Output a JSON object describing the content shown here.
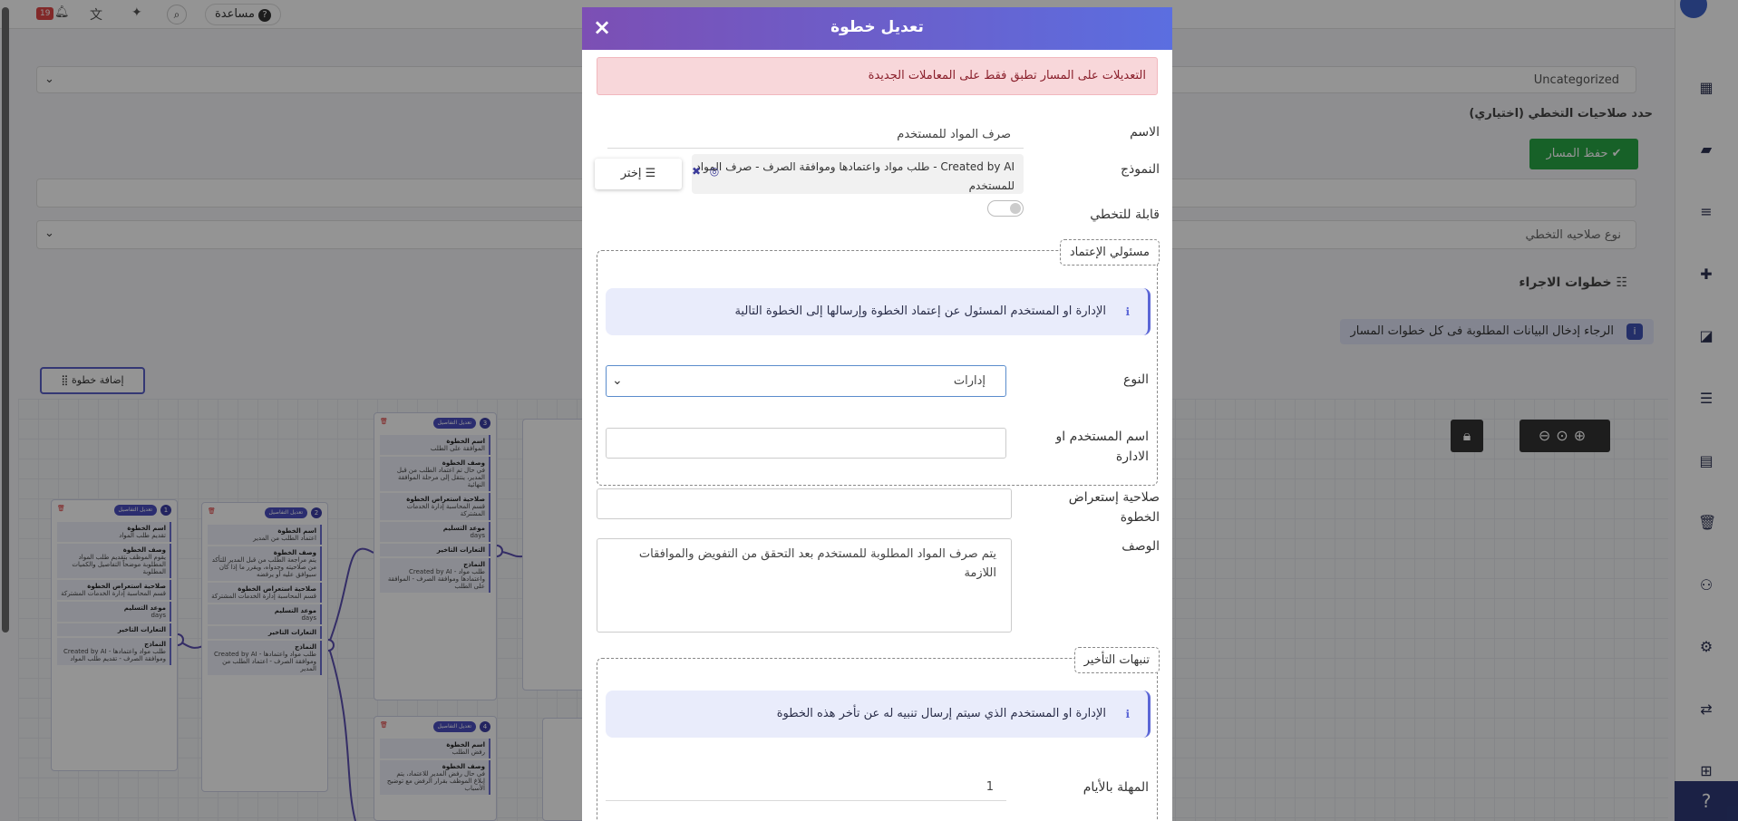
{
  "topbar": {
    "help_label": "مساعدة",
    "notification_count": "19"
  },
  "page": {
    "field_hint": "Uncategorized",
    "delegation_heading": "حدد صلاحيات التخطي (اختياري)",
    "save_path_label": "حفظ المسار",
    "delegation_type_placeholder": "نوع صلاحيه التخطي",
    "steps_heading": "خطوات الاجراء",
    "steps_notice": "الرجاء إدخال البيانات المطلوبة فى كل خطوات المسار",
    "add_step_label": "إضافة خطوة"
  },
  "flow_cards": [
    {
      "num": "1",
      "edit": "تعديل التفاصيل",
      "name_h": "اسم الخطوة",
      "name": "تقديم طلب المواد",
      "desc_h": "وصف الخطوة",
      "desc": "يقوم الموظف بتقديم طلب المواد المطلوبة موضحاً التفاصيل والكميات المطلوبة",
      "perm_h": "صلاحية استعراض الخطوة",
      "perm": "قسم المحاسبة إدارة الخدمات المشتركة",
      "due_h": "موعد التسليم",
      "due": "days",
      "alert_h": "التعارات التاخير",
      "model_h": "النماذج",
      "model": "Created by AI - طلب مواد واعتمادها وموافقة الصرف - تقديم طلب المواد"
    },
    {
      "num": "2",
      "edit": "تعديل التفاصيل",
      "name_h": "اسم الخطوة",
      "name": "اعتماد الطلب من المدير",
      "desc_h": "وصف الخطوة",
      "desc": "يتم مراجعة الطلب من قبل المدير للتأكد من صلاحيته وجدواه، ويقرر ما إذا كان سيوافق عليه أو يرفضه",
      "perm_h": "صلاحية استعراض الخطوة",
      "perm": "قسم المحاسبة إدارة الخدمات المشتركة",
      "due_h": "موعد التسليم",
      "due": "days",
      "alert_h": "التعارات التاخير",
      "model_h": "النماذج",
      "model": "Created by AI - طلب مواد واعتمادها وموافقة الصرف - اعتماد الطلب من المدير"
    },
    {
      "num": "3",
      "edit": "تعديل التفاصيل",
      "name_h": "اسم الخطوة",
      "name": "الموافقة على الطلب",
      "desc_h": "وصف الخطوة",
      "desc": "في حال تم اعتماد الطلب من قبل المدير، ينتقل إلى مرحلة الموافقة النهائية",
      "perm_h": "صلاحية استعراض الخطوة",
      "perm": "قسم المحاسبة إدارة الخدمات المشتركة",
      "due_h": "موعد التسليم",
      "due": "days",
      "alert_h": "التعارات التاخير",
      "model_h": "النماذج",
      "model": "Created by AI - طلب مواد واعتمادها وموافقة الصرف - الموافقة على الطلب"
    },
    {
      "num": "4",
      "edit": "تعديل التفاصيل",
      "name_h": "اسم الخطوة",
      "name": "رفض الطلب",
      "desc_h": "وصف الخطوة",
      "desc": "في حال رفض المدير للاعتماد، يتم إبلاغ الموظف بقرار الرفض مع توضيح الأسباب"
    }
  ],
  "modal": {
    "title": "تعديل خطوة",
    "close": "×",
    "alert": "التعديلات على المسار تطبق فقط على المعاملات الجديدة",
    "name_label": "الاسم",
    "name_value": "صرف المواد للمستخدم",
    "model_label": "النموذج",
    "model_value": "Created by AI - طلب مواد واعتمادها وموافقة الصرف - صرف المواد للمستخدم",
    "choose_label": "إختر",
    "skippable_label": "قابلة للتخطي",
    "approvers_legend": "مسئولي الإعتماد",
    "approvers_info": "الإدارة او المستخدم المسئول عن إعتماد الخطوة وإرسالها إلى الخطوة التالية",
    "type_label": "النوع",
    "type_value": "إدارات",
    "user_or_dept_label": "اسم المستخدم او الادارة",
    "view_perm_label": "صلاحية إستعراض الخطوة",
    "desc_label": "الوصف",
    "desc_value": "يتم صرف المواد المطلوبة للمستخدم بعد التحقق من التفويض والموافقات اللازمة",
    "delay_legend": "تنبهات التأخير",
    "delay_info": "الإدارة او المستخدم الذي سيتم إرسال تنبيه له عن تأخر هذه الخطوة",
    "days_label": "المهلة بالأيام",
    "days_value": "1"
  }
}
